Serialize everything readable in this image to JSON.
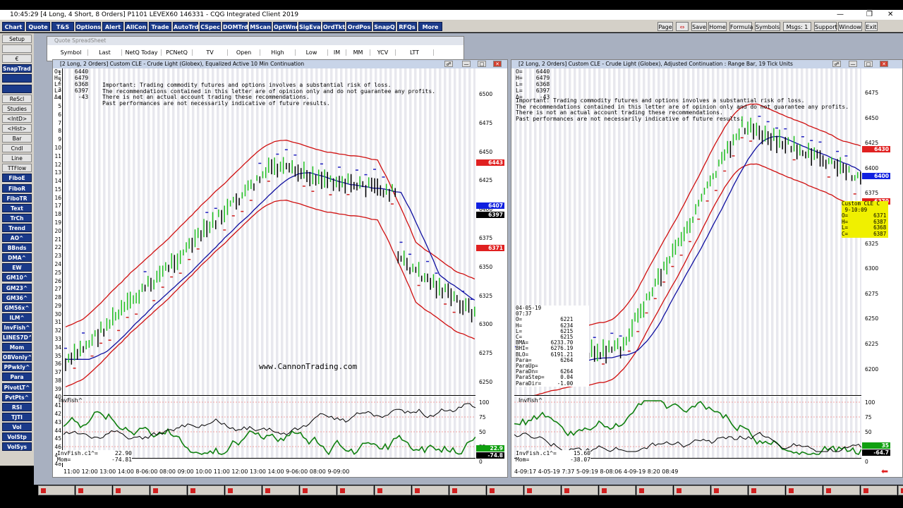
{
  "app": {
    "title": "10:45:29  [4 Long, 4 Short, 8 Orders]  P1101 LEVEX60  146331 - CQG Integrated Client 2019"
  },
  "menubar": {
    "left": [
      "Chart",
      "Quote",
      "T&S",
      "Options",
      "Alert",
      "AllCon",
      "Trade",
      "AutoTrd",
      "CSpec",
      "DOMTrd",
      "MScan",
      "OptWnd",
      "SigEval",
      "OrdTkt",
      "OrdPos",
      "SnapQ",
      "RFQs",
      "More"
    ],
    "right": [
      "Page",
      "Save",
      "Home",
      "Formula",
      "Symbols",
      "Msgs: 1",
      "Support",
      "Window",
      "Exit"
    ]
  },
  "leftbar": [
    "Setup",
    "",
    "€",
    "SnapTrader",
    "",
    "",
    "ReScl",
    "Studies",
    "<IntD>",
    "<Hist>",
    "Bar",
    "Cndl",
    "Line",
    "TTFlow",
    "FiboE",
    "FiboR",
    "FiboTR",
    "Text",
    "TrCh",
    "Trend",
    "AO^",
    "BBnds",
    "DMA^",
    "EW",
    "GM10^",
    "GM23^",
    "GM36^",
    "GM56x^",
    "ILM^",
    "InvFish^",
    "LINES7D^",
    "Mom",
    "OBVonly^",
    "PPwkly^",
    "Para",
    "PivotLT^",
    "PvtPts^",
    "RSI",
    "TJTI",
    "Vol",
    "VolStp",
    "VolSys"
  ],
  "quote": {
    "title": "Quote SpreadSheet",
    "cols": [
      "Symbol",
      "Last",
      "NetQ Today",
      "PCNetQ",
      "TV",
      "Open",
      "High",
      "Low",
      "IM",
      "MM",
      "YCV",
      "LTT"
    ]
  },
  "disclaimer": [
    "Important: Trading commodity futures and options involves a substantial risk of loss.",
    "The recommendations contained in this letter are of opinion only and do not guarantee any profits.",
    "There is not an actual account trading these recommendations.",
    "Past performances are not necessarily indicative of future results."
  ],
  "chart1": {
    "title": "[2 Long, 2 Orders]  Custom CLE - Crude Light (Globex), Equalized Active 10 Min Continuation",
    "ohlc": "O=    6440\nH=    6479\nL=    6368\nL=    6397\nΔ=     -43",
    "rows": [
      "1",
      "2",
      "3",
      "4",
      "5",
      "6",
      "7",
      "8",
      "9",
      "10",
      "11",
      "12",
      "13",
      "14",
      "15",
      "16",
      "17",
      "18",
      "19",
      "20",
      "21",
      "22",
      "23",
      "24",
      "25",
      "26",
      "27",
      "28",
      "29",
      "30",
      "31",
      "32",
      "33",
      "34",
      "35",
      "36",
      "37",
      "38",
      "39",
      "40",
      "41",
      "42",
      "43",
      "44",
      "45",
      "46",
      "47",
      "48"
    ],
    "prices": [
      "6500",
      "6475",
      "6450",
      "6425",
      "6400",
      "6375",
      "6350",
      "6325",
      "6300",
      "6275",
      "6250"
    ],
    "tags": [
      {
        "v": "6443",
        "c": "#e02020"
      },
      {
        "v": "6407",
        "c": "#1020e0"
      },
      {
        "v": "6397",
        "c": "#000"
      },
      {
        "v": "6371",
        "c": "#e02020"
      }
    ],
    "watermark": "www.CannonTrading.com",
    "ind_name": "InvFish^",
    "ind_lvls": [
      "100",
      "75",
      "50",
      "25",
      "0"
    ],
    "ind_vals": "InvFish.c1^=     22.90\nMom=            -74.81",
    "ind_tags": [
      "22.9",
      "-74.8"
    ],
    "xaxis": "11:00 12:00 13:00 14:00  8-06:00  08:00 09:00 10:00 11:00 12:00 13:00 14:00  9-06:00  08:00  9-09:00"
  },
  "chart2": {
    "title": "[2 Long, 2 Orders]  Custom CLE - Crude Light (Globex), Adjusted Continuation : Range Bar, 19 Tick Units",
    "ohlc": "O=    6440\nH=    6479\nL=    6368\nL=    6397\nΔ=     -43",
    "prices": [
      "6475",
      "6450",
      "6425",
      "6400",
      "6375",
      "6350",
      "6325",
      "6300",
      "6275",
      "6250",
      "6225",
      "6200"
    ],
    "tags": [
      {
        "v": "6430",
        "c": "#e02020"
      },
      {
        "v": "6400",
        "c": "#1020e0"
      },
      {
        "v": "6370",
        "c": "#e02020"
      }
    ],
    "cursor": "Custom CLE C\n 9-10:09\nO=        6371\nH=        6387\nL=        6368\nC=        6387",
    "datapanel": "04-05-19\n07:37\nO=            6221\nH=            6234\nL=            6215\nC=            6215\nBMA=       6233.70\nBHI=       6276.19\nBLO=       6191.21\nPara=         6264\nParaUp=\nParaDn=       6264\nParaStep=     0.04\nParaDir=     -1.00",
    "ind_name": "InvFish^",
    "ind_lvls": [
      "100",
      "75",
      "50",
      "25",
      "0"
    ],
    "ind_vals": "InvFish.c1^=     15.60\nMom=            -38.07",
    "ind_tags": [
      "35",
      "-64.7"
    ],
    "xaxis": "   4-09:17      4-05-19  7:37  5-09:19     8-08:06      4-09-19  8:20 08:49"
  }
}
